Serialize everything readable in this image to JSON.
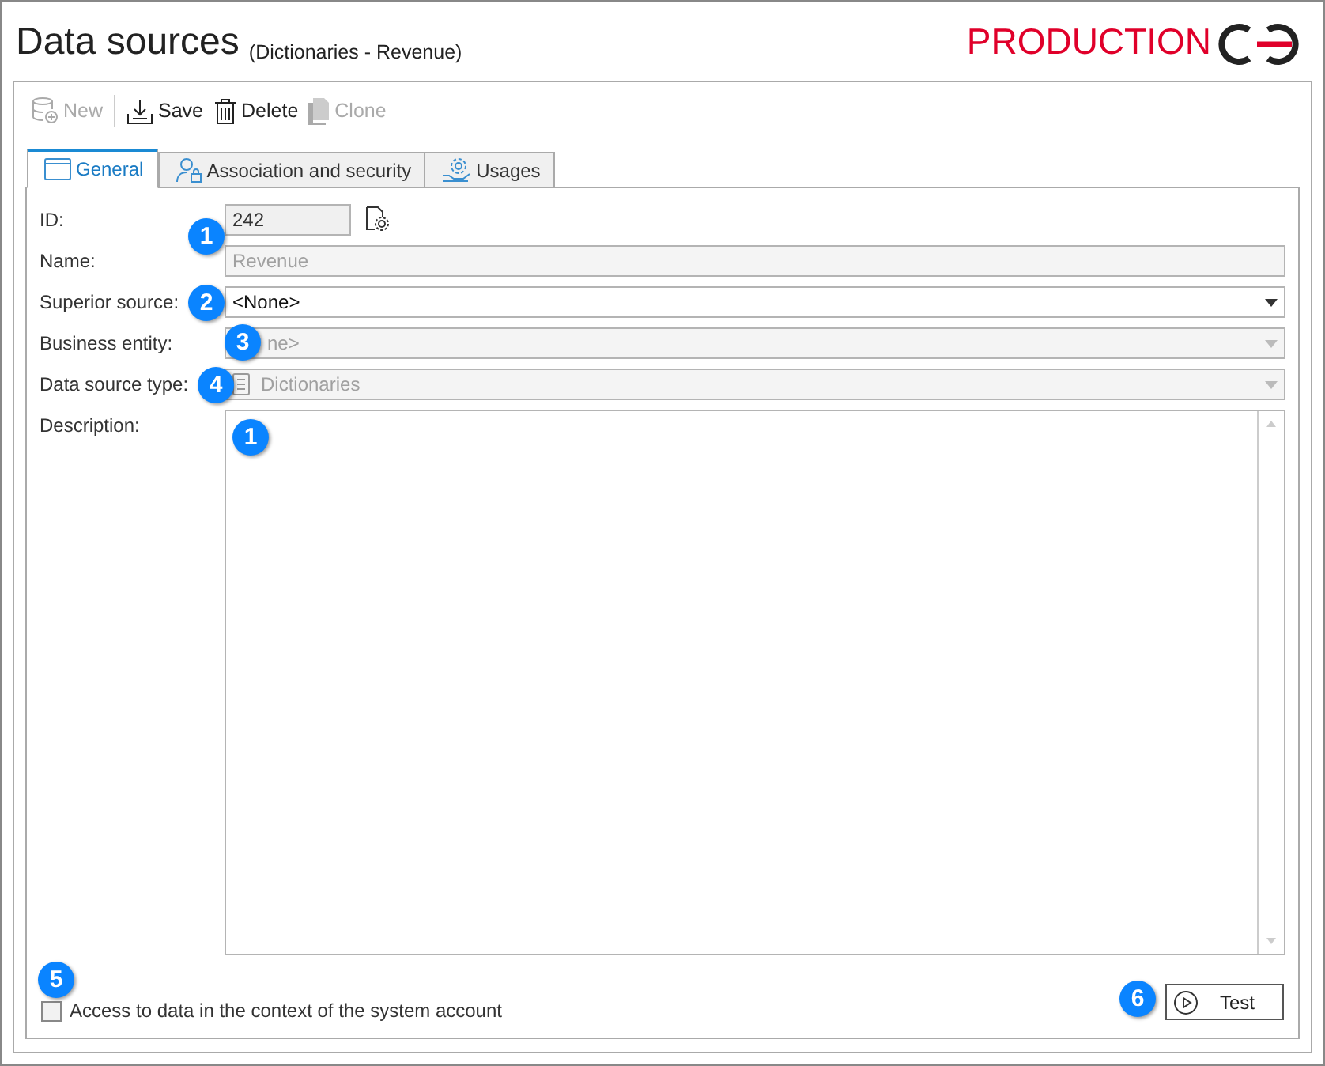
{
  "window": {
    "title": "Data sources",
    "subtitle": "(Dictionaries - Revenue)",
    "environment": "PRODUCTION"
  },
  "toolbar": [
    {
      "label": "New",
      "kind": "new",
      "disabled": true
    },
    {
      "label": "Save",
      "kind": "save",
      "disabled": false
    },
    {
      "label": "Delete",
      "kind": "delete",
      "disabled": false
    },
    {
      "label": "Clone",
      "kind": "clone",
      "disabled": true
    }
  ],
  "tabs": [
    {
      "label": "General",
      "kind": "window",
      "selected": true
    },
    {
      "label": "Association and security",
      "kind": "person",
      "selected": false
    },
    {
      "label": "Usages",
      "kind": "gear",
      "selected": false
    }
  ],
  "fields": [
    {
      "label": "ID:",
      "kind": "id",
      "value": "242",
      "disabled": true,
      "badge": "1"
    },
    {
      "label": "Name:",
      "kind": "text",
      "value": "Revenue",
      "disabled": true
    },
    {
      "label": "Superior source:",
      "kind": "select",
      "value": "<None>",
      "disabled": false,
      "badge": "2"
    },
    {
      "label": "Business entity:",
      "kind": "select",
      "value": "ne>",
      "disabled": true,
      "badge": "3"
    },
    {
      "label": "Data source type:",
      "kind": "select",
      "value": "Dictionaries",
      "icon": true,
      "disabled": true,
      "badge": "4"
    },
    {
      "label": "Description:",
      "kind": "textarea",
      "badge": "1"
    }
  ],
  "checkbox": {
    "label": "Access to data in the context of the system account",
    "checked": false,
    "badge": "5"
  },
  "test_button": {
    "label": "Test",
    "badge": "6"
  }
}
